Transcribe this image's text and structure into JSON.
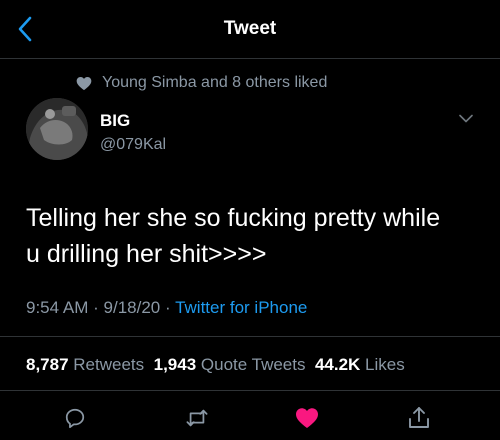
{
  "header": {
    "title": "Tweet",
    "back_icon": "chevron-left-icon"
  },
  "social_context": {
    "icon": "heart-icon",
    "text": "Young Simba and 8 others liked"
  },
  "tweet": {
    "author": {
      "display_name": "BIG",
      "handle": "@079Kal"
    },
    "text_line1": "Telling her she so fucking pretty while",
    "text_line2": "u drilling her shit>>>>",
    "time": "9:54 AM",
    "date": "9/18/20",
    "separator": "·",
    "source": "Twitter for iPhone"
  },
  "stats": {
    "retweets_count": "8,787",
    "retweets_label": "Retweets",
    "quote_count": "1,943",
    "quote_label": "Quote Tweets",
    "likes_count": "44.2K",
    "likes_label": "Likes"
  },
  "actions": {
    "icons": [
      "reply-icon",
      "retweet-icon",
      "like-icon",
      "share-icon"
    ],
    "like_color": "#f91880"
  },
  "colors": {
    "background": "#000000",
    "text": "#ffffff",
    "secondary": "#8b98a5",
    "accent": "#1d9bf0",
    "divider": "#2f3336"
  }
}
